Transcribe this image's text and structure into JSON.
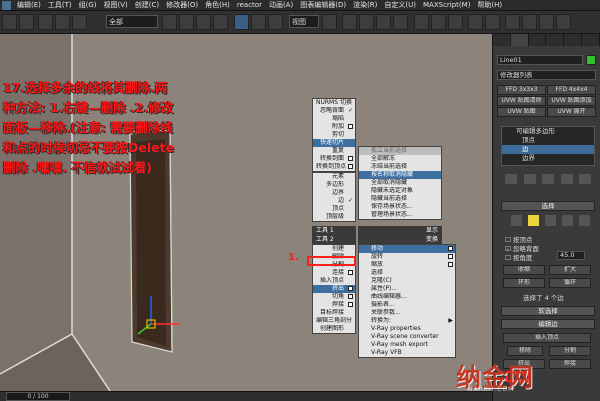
{
  "menubar": {
    "items": [
      "编辑(E)",
      "工具(T)",
      "组(G)",
      "视图(V)",
      "创建(C)",
      "修改器(O)",
      "角色(H)",
      "reactor",
      "动画(A)",
      "图表编辑器(D)",
      "渲染(R)",
      "自定义(U)",
      "MAXScript(M)",
      "帮助(H)"
    ]
  },
  "toolbar": {
    "selection_filter": "全部",
    "coord_system": "视图",
    "accent": "#3a5f86"
  },
  "tutorial": {
    "text": "17.选择多余的线将其删除.两种方法: 1.右键—删除 .2.修改面板—移除.(注意: 需要删除线和点的时候切忌不要按Delete删除 .嘿嘿. 不信就试试看)",
    "color": "#ff1515"
  },
  "context_menu": {
    "top": {
      "items": [
        "NURMS 切换",
        "忽略背面",
        "塌陷",
        "附加",
        "剪切",
        "快速切片",
        "重复",
        "转换到面",
        "转换到顶点"
      ],
      "checked": "忽略背面",
      "highlighted": "快速切片"
    },
    "left_mid": {
      "items": [
        "元素",
        "多边形",
        "边界",
        "边",
        "顶点",
        "顶层级"
      ],
      "checked": "边"
    },
    "right_mid": {
      "title": "孤立当前选择",
      "items": [
        "全部解冻",
        "冻结当前选择",
        "按名称取消隐藏",
        "全部取消隐藏",
        "隐藏未选定对象",
        "隐藏当前选择",
        "保存场景状态...",
        "管理场景状态..."
      ],
      "highlighted": "按名称取消隐藏"
    },
    "tools1": {
      "title": "工具 1",
      "right_title": "显示",
      "title_right2": "变换"
    },
    "tools2_title": "工具 2",
    "left_lower": {
      "items": [
        "创建",
        "删除",
        "分割",
        "连接",
        "插入顶点",
        "挤出",
        "切角",
        "焊接",
        "目标焊接",
        "编辑三角剖分",
        "创建图形"
      ],
      "highlighted": "挤出"
    },
    "right_lower": {
      "items": [
        "移动",
        "旋转",
        "缩放",
        "选择",
        "克隆(C)",
        "属性(P)...",
        "曲线编辑器...",
        "摄影表...",
        "关联参数...",
        "转换为:",
        "V-Ray properties",
        "V-Ray scene converter",
        "V-Ray mesh export",
        "V-Ray VFB"
      ],
      "highlighted": "移动"
    }
  },
  "annotation": {
    "arrow_label": "1.",
    "box_color": "#ff1e1e"
  },
  "command_panel": {
    "object_name": "Line01",
    "object_color": "#2fbf2f",
    "modifier_list": "修改器列表",
    "buttons": [
      "FFD 3x3x3",
      "FFD 4x4x4",
      "UVW 贴图清除",
      "UVW 贴图添加",
      "UVW 贴图",
      "UVW 展开"
    ],
    "stack": [
      {
        "label": "可编辑多边形",
        "selected": false
      },
      {
        "label": "顶点",
        "selected": false
      },
      {
        "label": "边",
        "selected": true
      },
      {
        "label": "边界",
        "selected": false
      }
    ],
    "rollout_select": "选择",
    "by_vertex": "按顶点",
    "ignore_backface": "忽略背面",
    "by_angle": "按角度",
    "angle_value": "45.0",
    "shrink": "收缩",
    "grow": "扩大",
    "ring": "环形",
    "loop": "循环",
    "selected_count": "选择了 4 个边",
    "soft_select": "软选择",
    "edit_edges": "编辑边",
    "insert_vertex": "插入顶点",
    "remove": "移除",
    "split": "分割",
    "extrude": "挤出",
    "weld": "焊接"
  },
  "statusbar": {
    "frame": "0 / 100"
  },
  "watermark": {
    "logo": "纳金网",
    "url": "NARKII.COM"
  }
}
